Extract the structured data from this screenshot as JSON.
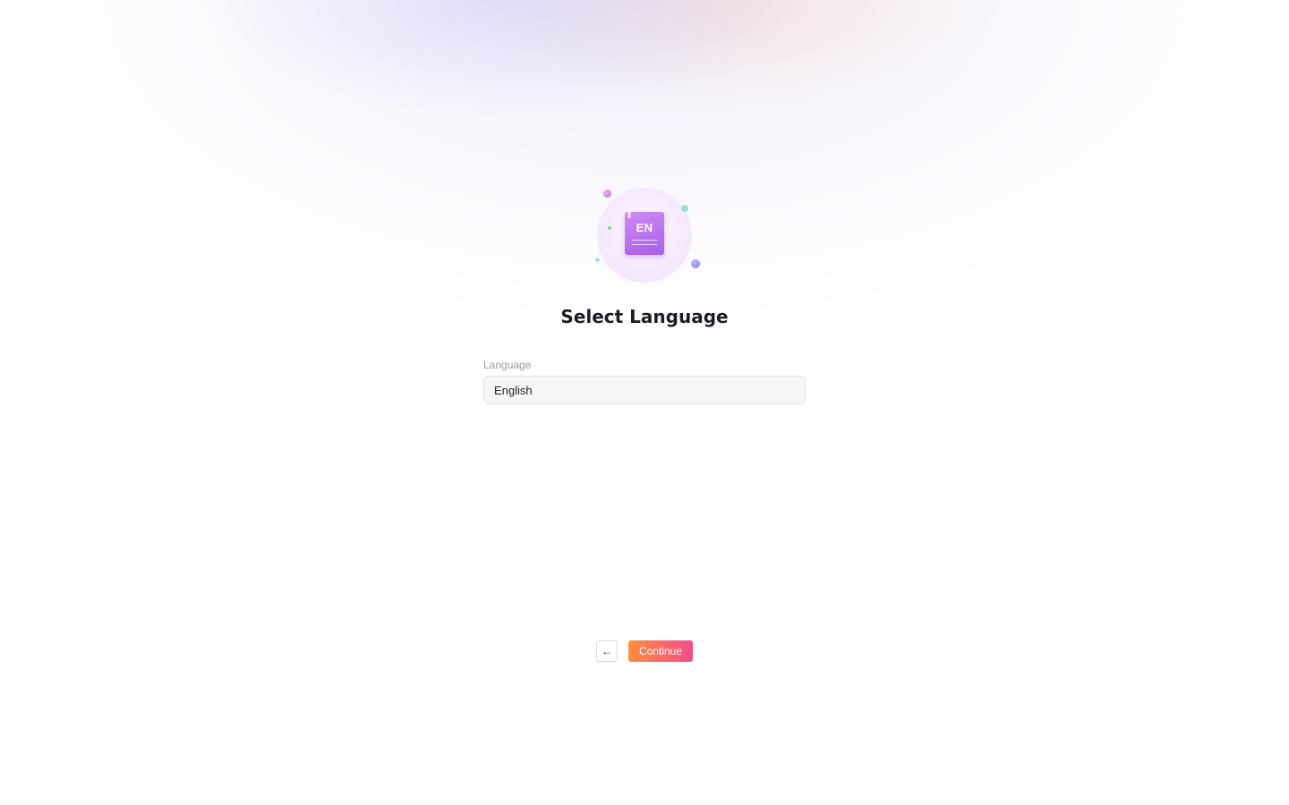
{
  "hero": {
    "badge_text": "EN",
    "icon": "language-book-icon"
  },
  "title": "Select Language",
  "form": {
    "language_label": "Language",
    "language_value": "English"
  },
  "nav": {
    "back_icon": "arrow-left-icon",
    "back_glyph": "←",
    "continue_label": "Continue"
  },
  "colors": {
    "accent_start": "#fb8e3e",
    "accent_end": "#f44d8a",
    "book_purple": "#b56cec"
  }
}
